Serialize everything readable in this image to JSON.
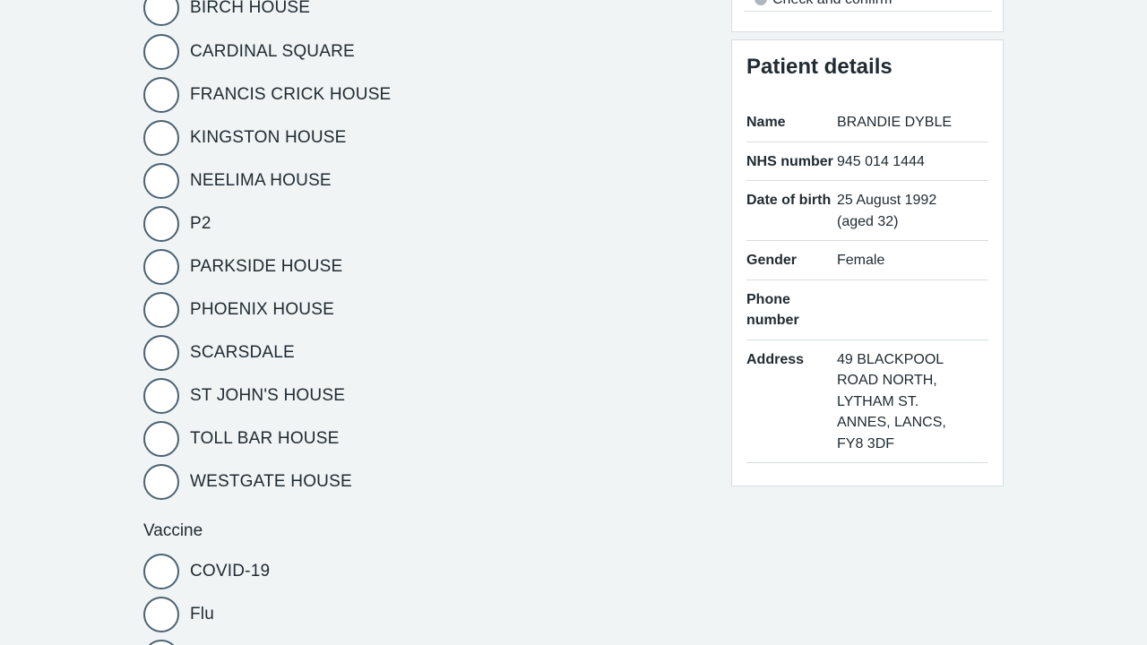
{
  "site_options": [
    "BIRCH HOUSE",
    "CARDINAL SQUARE",
    "FRANCIS CRICK HOUSE",
    "KINGSTON HOUSE",
    "NEELIMA HOUSE",
    "P2",
    "PARKSIDE HOUSE",
    "PHOENIX HOUSE",
    "SCARSDALE",
    "ST JOHN'S HOUSE",
    "TOLL BAR HOUSE",
    "WESTGATE HOUSE"
  ],
  "vaccine": {
    "legend": "Vaccine",
    "options": [
      "COVID-19",
      "Flu",
      ""
    ]
  },
  "task_list": {
    "items": [
      {
        "label": "Check and confirm",
        "icon": "status-circle-icon"
      }
    ]
  },
  "patient_details": {
    "title": "Patient details",
    "rows": [
      {
        "label": "Name",
        "value": "BRANDIE DYBLE"
      },
      {
        "label": "NHS number",
        "value": "945 014 1444"
      },
      {
        "label": "Date of birth",
        "value": "25 August 1992 (aged 32)"
      },
      {
        "label": "Gender",
        "value": "Female"
      },
      {
        "label": "Phone number",
        "value": ""
      },
      {
        "label": "Address",
        "value": "49 BLACKPOOL ROAD NORTH, LYTHAM ST. ANNES, LANCS, FY8 3DF"
      }
    ]
  },
  "colors": {
    "background": "#f0f4f5",
    "text": "#212b32",
    "radio_border": "#4c6272",
    "card_border": "#d8dde0"
  }
}
